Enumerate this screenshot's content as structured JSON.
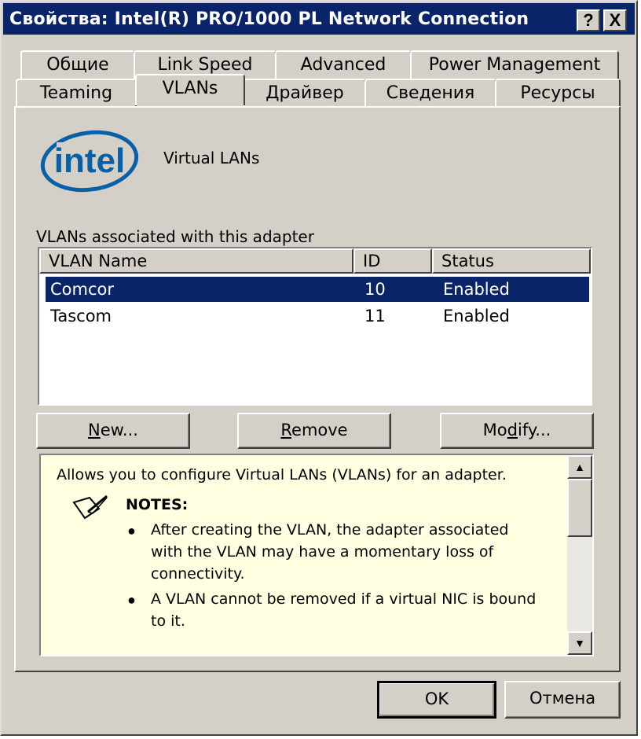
{
  "window": {
    "title": "Свойства: Intel(R) PRO/1000 PL Network Connection",
    "help_button": "?",
    "close_button": "X"
  },
  "tabs": {
    "row1": [
      {
        "label": "Общие"
      },
      {
        "label": "Link Speed"
      },
      {
        "label": "Advanced"
      },
      {
        "label": "Power Management"
      }
    ],
    "row2": [
      {
        "label": "Teaming"
      },
      {
        "label": "VLANs",
        "active": true
      },
      {
        "label": "Драйвер"
      },
      {
        "label": "Сведения"
      },
      {
        "label": "Ресурсы"
      }
    ]
  },
  "logo": {
    "text": "intel",
    "color": "#0860a8"
  },
  "section_title": "Virtual LANs",
  "vlan_list": {
    "caption": "VLANs associated with this adapter",
    "columns": [
      "VLAN Name",
      "ID",
      "Status"
    ],
    "rows": [
      {
        "name": "Comcor",
        "id": "10",
        "status": "Enabled",
        "selected": true
      },
      {
        "name": "Tascom",
        "id": "11",
        "status": "Enabled",
        "selected": false
      }
    ]
  },
  "buttons": {
    "new": {
      "prefix": "",
      "mnemonic": "N",
      "rest": "ew..."
    },
    "remove": {
      "prefix": "",
      "mnemonic": "R",
      "rest": "emove"
    },
    "modify": {
      "prefix": "Mo",
      "mnemonic": "d",
      "rest": "ify..."
    },
    "ok": "OK",
    "cancel": "Отмена"
  },
  "help": {
    "intro": "Allows you to configure Virtual LANs (VLANs) for an adapter.",
    "notes_heading": "NOTES:",
    "notes": [
      {
        "lines": [
          "After creating the VLAN, the adapter associated",
          "with the VLAN may have a momentary loss of",
          "connectivity."
        ]
      },
      {
        "lines": [
          "A VLAN cannot be removed if a virtual NIC is bound",
          "to it."
        ]
      }
    ],
    "background": "#ffffe1"
  },
  "colors": {
    "titlebar": "#0a246a",
    "face": "#d4d0c8",
    "selection": "#0a246a"
  }
}
